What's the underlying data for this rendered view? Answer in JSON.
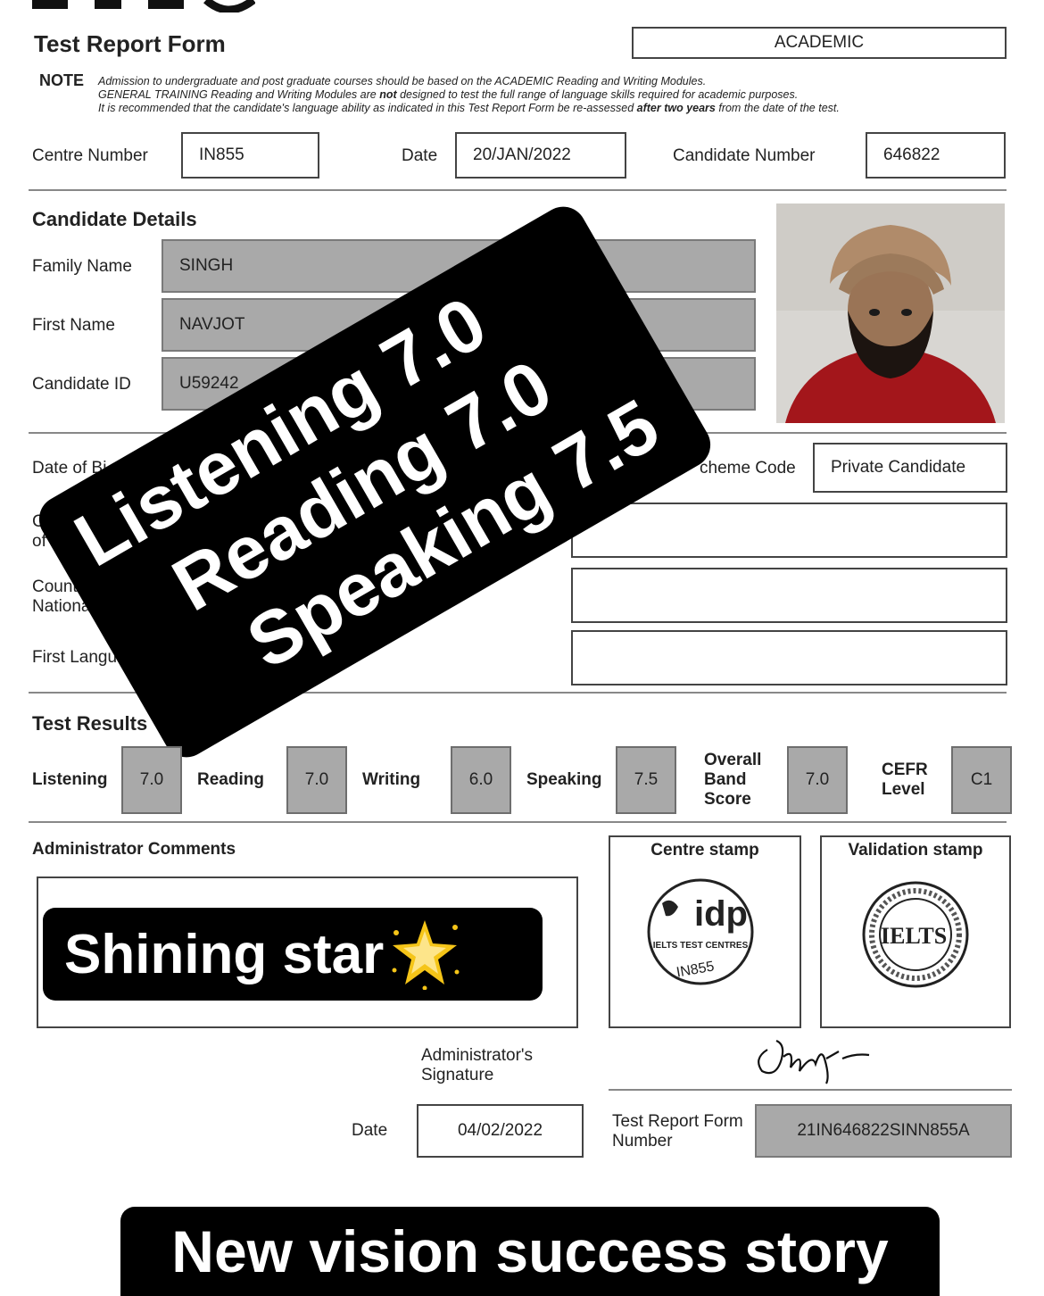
{
  "header": {
    "form_title": "Test Report Form",
    "module": "ACADEMIC",
    "note_label": "NOTE",
    "note_line1": "Admission to undergraduate and post graduate courses should be based on the ACADEMIC Reading and Writing Modules.",
    "note_line2_a": "GENERAL TRAINING Reading and Writing Modules are ",
    "note_line2_b": "not",
    "note_line2_c": " designed to test the full range of language skills required for academic purposes.",
    "note_line3_a": "It is recommended that the candidate's language ability as indicated in this Test Report Form be re-assessed ",
    "note_line3_b": "after two years",
    "note_line3_c": " from the date of the test."
  },
  "centre": {
    "centre_number_label": "Centre Number",
    "centre_number": "IN855",
    "date_label": "Date",
    "date": "20/JAN/2022",
    "candidate_number_label": "Candidate Number",
    "candidate_number": "646822"
  },
  "candidate": {
    "section_title": "Candidate Details",
    "family_name_label": "Family Name",
    "family_name": "SINGH",
    "first_name_label": "First Name",
    "first_name": "NAVJOT",
    "candidate_id_label": "Candidate ID",
    "candidate_id": "U59242",
    "dob_label": "Date of Bi",
    "scheme_code_label": "cheme Code",
    "scheme_code": "Private Candidate",
    "country_origin_label_1": "Co",
    "country_origin_label_2": "of O",
    "country_nat_label_1": "Country",
    "country_nat_label_2": "Nationality",
    "first_language_label": "First Language"
  },
  "results": {
    "section_title": "Test Results",
    "listening_label": "Listening",
    "listening": "7.0",
    "reading_label": "Reading",
    "reading": "7.0",
    "writing_label": "Writing",
    "writing": "6.0",
    "speaking_label": "Speaking",
    "speaking": "7.5",
    "overall_label_1": "Overall",
    "overall_label_2": "Band",
    "overall_label_3": "Score",
    "overall": "7.0",
    "cefr_label_1": "CEFR",
    "cefr_label_2": "Level",
    "cefr": "C1"
  },
  "admin": {
    "comments_label": "Administrator Comments",
    "centre_stamp_label": "Centre stamp",
    "validation_stamp_label": "Validation stamp",
    "idp_logo": "idp",
    "idp_text": "IELTS TEST CENTRES",
    "idp_code": "IN855",
    "ielts_logo": "IELTS",
    "signature_label_1": "Administrator's",
    "signature_label_2": "Signature",
    "date_label": "Date",
    "date": "04/02/2022",
    "trf_label_1": "Test Report Form",
    "trf_label_2": "Number",
    "trf_number": "21IN646822SINN855A"
  },
  "overlays": {
    "score_line1": "Listening 7.0",
    "score_line2": "Reading 7.0",
    "score_line3": "Speaking 7.5",
    "comment_sticker": "Shining star",
    "comment_icon": "sparkle-star-icon",
    "footer_banner": "New vision success story"
  },
  "colors": {
    "grey_field": "#a9a9a9",
    "sticker_bg": "#000000",
    "star": "#f5c518"
  }
}
